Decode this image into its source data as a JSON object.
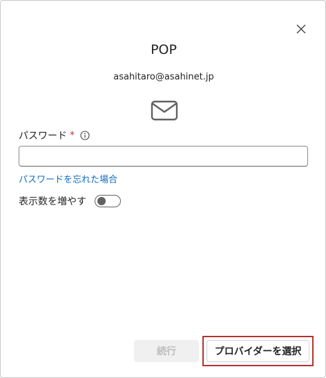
{
  "dialog": {
    "title": "POP",
    "email": "asahitaro@asahinet.jp"
  },
  "password": {
    "label": "パスワード",
    "required_mark": "*",
    "value": "",
    "placeholder": ""
  },
  "links": {
    "forgot": "パスワードを忘れた場合"
  },
  "options": {
    "show_more_label": "表示数を増やす",
    "show_more_enabled": false
  },
  "buttons": {
    "continue_label": "続行",
    "choose_provider_label": "プロバイダーを選択"
  },
  "icons": {
    "close": "close-icon",
    "mail": "mail-icon",
    "info": "info-icon"
  },
  "colors": {
    "link": "#0f6cbd",
    "required": "#c4314b",
    "highlight": "#b3322e",
    "disabled_bg": "#f0f0f0",
    "disabled_text": "#bdbdbd"
  }
}
